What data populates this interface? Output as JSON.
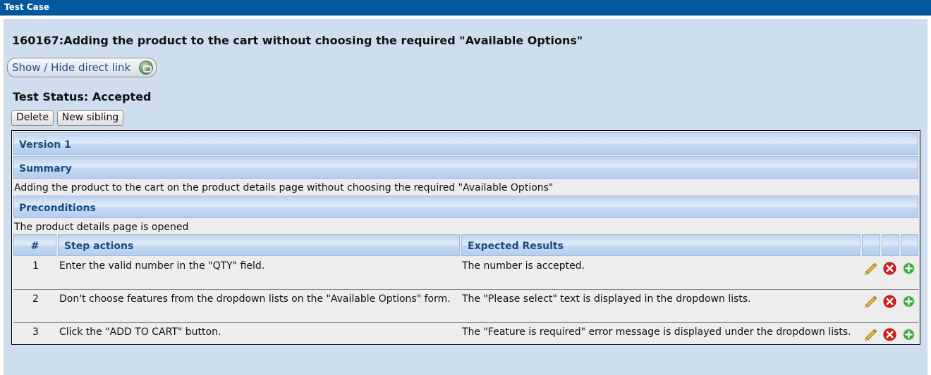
{
  "window": {
    "title": "Test Case"
  },
  "testcase": {
    "title": "160167:Adding the product to the cart without choosing the required \"Available Options\"",
    "direct_link_label": "Show / Hide direct link",
    "status_text": "Test Status: Accepted"
  },
  "actions": {
    "delete_label": "Delete",
    "new_sibling_label": "New sibling"
  },
  "version": {
    "label": "Version 1"
  },
  "summary": {
    "heading": "Summary",
    "text": "Adding the product to the cart on the product details page without choosing the required \"Available Options\""
  },
  "preconditions": {
    "heading": "Preconditions",
    "text": "The product details page is opened"
  },
  "steps_table": {
    "columns": {
      "num": "#",
      "actions": "Step actions",
      "expected": "Expected Results"
    },
    "rows": [
      {
        "num": "1",
        "action": "Enter the valid number in the \"QTY\" field.",
        "expected": "The number is accepted."
      },
      {
        "num": "2",
        "action": "Don't choose features from the dropdown lists on the \"Available Options\" form.",
        "expected": "The \"Please select\" text is displayed in the dropdown lists."
      },
      {
        "num": "3",
        "action": "Click the \"ADD TO CART\" button.",
        "expected": "The \"Feature is required\" error message is displayed under the dropdown lists."
      }
    ]
  },
  "colors": {
    "titlebar": "#00589e",
    "panel": "#cedeee",
    "header_text": "#1a4a85",
    "delete_icon": "#d42020",
    "add_icon": "#3ea83e",
    "edit_icon": "#e6b83a"
  },
  "icons": {
    "row_edit": "pencil-icon",
    "row_delete": "delete-x-icon",
    "row_add": "add-plus-icon",
    "direct_link": "link-globe-icon"
  }
}
